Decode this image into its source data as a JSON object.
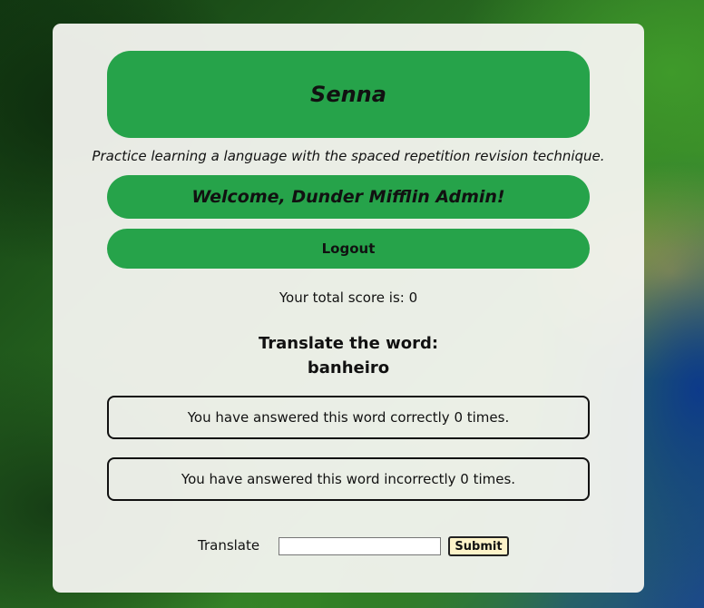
{
  "app": {
    "title": "Senna",
    "tagline": "Practice learning a language with the spaced repetition revision technique."
  },
  "user": {
    "welcome": "Welcome, Dunder Mifflin Admin!"
  },
  "actions": {
    "logout_label": "Logout",
    "submit_label": "Submit"
  },
  "score": {
    "text": "Your total score is: 0"
  },
  "word": {
    "prompt": "Translate the word:",
    "current": "banheiro",
    "correct_text": "You have answered this word correctly 0 times.",
    "incorrect_text": "You have answered this word incorrectly 0 times."
  },
  "form": {
    "label": "Translate",
    "value": ""
  },
  "colors": {
    "accent_green": "#26a34a",
    "submit_bg": "#fdf3c9"
  }
}
